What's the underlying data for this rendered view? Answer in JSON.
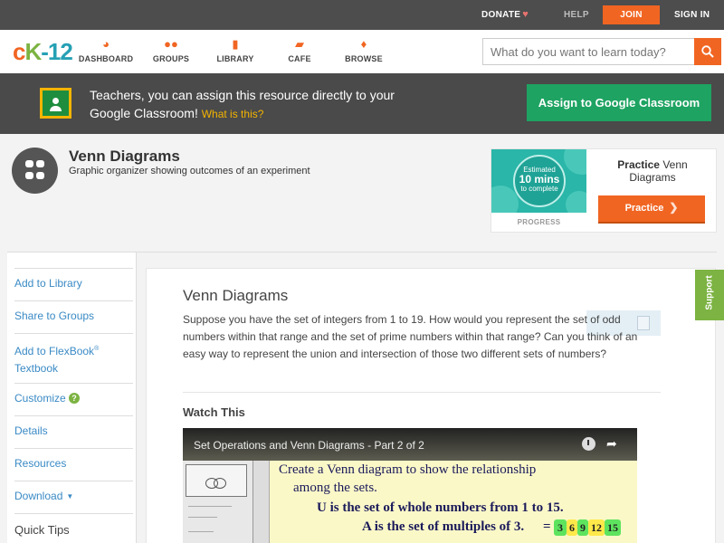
{
  "topbar": {
    "donate": "DONATE",
    "help": "HELP",
    "join": "JOIN",
    "signin": "SIGN IN"
  },
  "logo": {
    "c": "c",
    "k": "K",
    "num": "-12"
  },
  "nav": {
    "items": [
      {
        "label": "DASHBOARD",
        "icon": "dashboard-icon"
      },
      {
        "label": "GROUPS",
        "icon": "groups-icon"
      },
      {
        "label": "LIBRARY",
        "icon": "library-icon"
      },
      {
        "label": "CAFE",
        "icon": "cafe-icon"
      },
      {
        "label": "BROWSE",
        "icon": "browse-icon"
      }
    ],
    "search_placeholder": "What do you want to learn today?"
  },
  "banner": {
    "text": "Teachers, you can assign this resource directly to your Google Classroom!",
    "what": "What is this?",
    "button": "Assign to Google Classroom"
  },
  "concept": {
    "title": "Venn Diagrams",
    "subtitle": "Graphic organizer showing outcomes of an experiment"
  },
  "practice": {
    "estimated": "Estimated",
    "mins": "10 mins",
    "complete": "to complete",
    "progress_label": "PROGRESS",
    "title_bold": "Practice",
    "title_rest": "Venn Diagrams",
    "button": "Practice"
  },
  "sidebar": {
    "add_library": "Add to Library",
    "share_groups": "Share to Groups",
    "add_flexbook": "Add to FlexBook",
    "flexbook_reg": "®",
    "textbook": "Textbook",
    "customize": "Customize",
    "customize_help": "?",
    "details": "Details",
    "resources": "Resources",
    "download": "Download",
    "quick_tips": "Quick Tips"
  },
  "content": {
    "title": "Venn Diagrams",
    "body": "Suppose you have the set of integers from 1 to 19. How would you represent the set of odd numbers within that range and the set of prime numbers within that range? Can you think of an easy way to represent the union and intersection of those two different sets of numbers?",
    "watch": "Watch This"
  },
  "video": {
    "title": "Set Operations and Venn Diagrams - Part 2 of 2",
    "line1": "Create a Venn diagram to show the relationship",
    "line2": "among the sets.",
    "line3": "U is the set of whole numbers from 1 to 15.",
    "line4": "A is the set of multiples of 3.",
    "eq": "=",
    "multiples": [
      "3",
      "6",
      "9",
      "12",
      "15"
    ]
  },
  "support": {
    "label": "Support"
  },
  "colors": {
    "accent": "#f16522",
    "green": "#1ea362",
    "link": "#3a8ac5",
    "support": "#7cb342"
  }
}
